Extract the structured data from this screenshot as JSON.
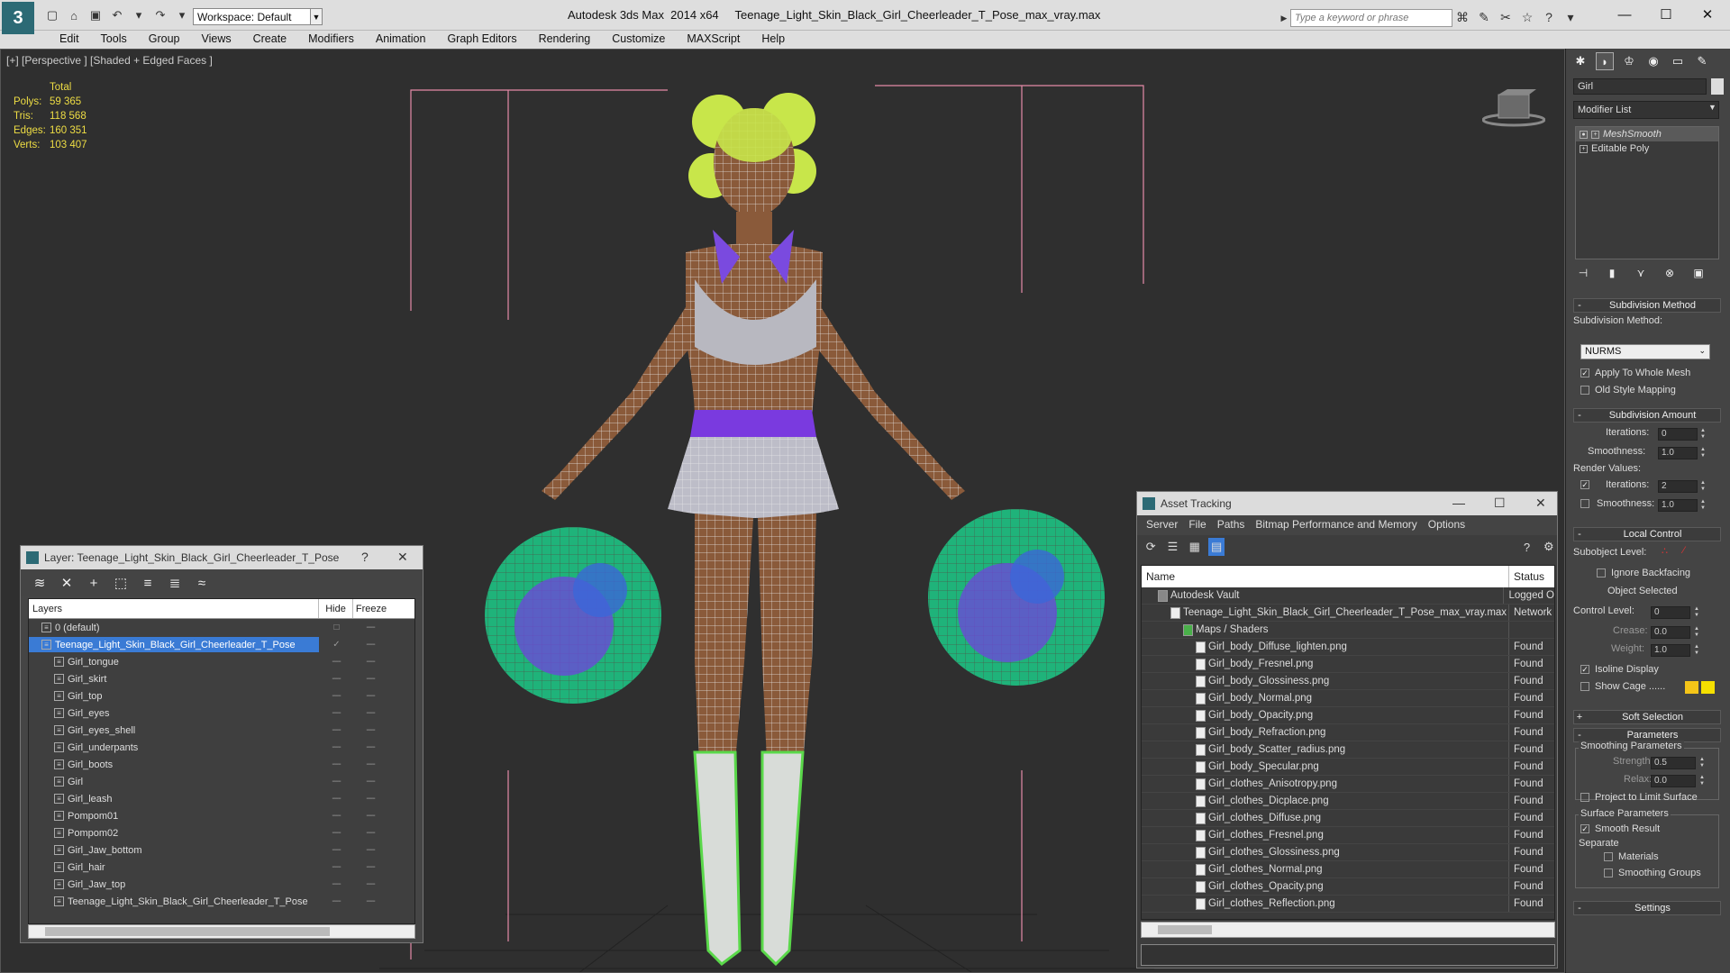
{
  "titlebar": {
    "workspace": "Workspace: Default",
    "app": "Autodesk 3ds Max  2014 x64",
    "file": "Teenage_Light_Skin_Black_Girl_Cheerleader_T_Pose_max_vray.max",
    "search_placeholder": "Type a keyword or phrase"
  },
  "menu": [
    "Edit",
    "Tools",
    "Group",
    "Views",
    "Create",
    "Modifiers",
    "Animation",
    "Graph Editors",
    "Rendering",
    "Customize",
    "MAXScript",
    "Help"
  ],
  "viewport": {
    "label": "[+] [Perspective ] [Shaded + Edged Faces ]",
    "stats_header": "Total",
    "stats": [
      {
        "label": "Polys:",
        "value": "59 365"
      },
      {
        "label": "Tris:",
        "value": "118 568"
      },
      {
        "label": "Edges:",
        "value": "160 351"
      },
      {
        "label": "Verts:",
        "value": "103 407"
      }
    ]
  },
  "layer_window": {
    "title": "Layer: Teenage_Light_Skin_Black_Girl_Cheerleader_T_Pose",
    "help": "?",
    "col_layers": "Layers",
    "col_hide": "Hide",
    "col_freeze": "Freeze",
    "rows": [
      {
        "name": "0 (default)",
        "indent": 1
      },
      {
        "name": "Teenage_Light_Skin_Black_Girl_Cheerleader_T_Pose",
        "indent": 1,
        "selected": true
      },
      {
        "name": "Girl_tongue",
        "indent": 2
      },
      {
        "name": "Girl_skirt",
        "indent": 2
      },
      {
        "name": "Girl_top",
        "indent": 2
      },
      {
        "name": "Girl_eyes",
        "indent": 2
      },
      {
        "name": "Girl_eyes_shell",
        "indent": 2
      },
      {
        "name": "Girl_underpants",
        "indent": 2
      },
      {
        "name": "Girl_boots",
        "indent": 2
      },
      {
        "name": "Girl",
        "indent": 2
      },
      {
        "name": "Girl_leash",
        "indent": 2
      },
      {
        "name": "Pompom01",
        "indent": 2
      },
      {
        "name": "Pompom02",
        "indent": 2
      },
      {
        "name": "Girl_Jaw_bottom",
        "indent": 2
      },
      {
        "name": "Girl_hair",
        "indent": 2
      },
      {
        "name": "Girl_Jaw_top",
        "indent": 2
      },
      {
        "name": "Teenage_Light_Skin_Black_Girl_Cheerleader_T_Pose",
        "indent": 2
      }
    ]
  },
  "asset_window": {
    "title": "Asset Tracking",
    "menu": [
      "Server",
      "File",
      "Paths",
      "Bitmap Performance and Memory",
      "Options"
    ],
    "col_name": "Name",
    "col_status": "Status",
    "rows": [
      {
        "name": "Autodesk Vault",
        "status": "Logged O",
        "indent": 1
      },
      {
        "name": "Teenage_Light_Skin_Black_Girl_Cheerleader_T_Pose_max_vray.max",
        "status": "Network",
        "indent": 2
      },
      {
        "name": "Maps / Shaders",
        "status": "",
        "indent": 3
      },
      {
        "name": "Girl_body_Diffuse_lighten.png",
        "status": "Found",
        "indent": 4
      },
      {
        "name": "Girl_body_Fresnel.png",
        "status": "Found",
        "indent": 4
      },
      {
        "name": "Girl_body_Glossiness.png",
        "status": "Found",
        "indent": 4
      },
      {
        "name": "Girl_body_Normal.png",
        "status": "Found",
        "indent": 4
      },
      {
        "name": "Girl_body_Opacity.png",
        "status": "Found",
        "indent": 4
      },
      {
        "name": "Girl_body_Refraction.png",
        "status": "Found",
        "indent": 4
      },
      {
        "name": "Girl_body_Scatter_radius.png",
        "status": "Found",
        "indent": 4
      },
      {
        "name": "Girl_body_Specular.png",
        "status": "Found",
        "indent": 4
      },
      {
        "name": "Girl_clothes_Anisotropy.png",
        "status": "Found",
        "indent": 4
      },
      {
        "name": "Girl_clothes_Dicplace.png",
        "status": "Found",
        "indent": 4
      },
      {
        "name": "Girl_clothes_Diffuse.png",
        "status": "Found",
        "indent": 4
      },
      {
        "name": "Girl_clothes_Fresnel.png",
        "status": "Found",
        "indent": 4
      },
      {
        "name": "Girl_clothes_Glossiness.png",
        "status": "Found",
        "indent": 4
      },
      {
        "name": "Girl_clothes_Normal.png",
        "status": "Found",
        "indent": 4
      },
      {
        "name": "Girl_clothes_Opacity.png",
        "status": "Found",
        "indent": 4
      },
      {
        "name": "Girl_clothes_Reflection.png",
        "status": "Found",
        "indent": 4
      }
    ]
  },
  "command_panel": {
    "object_name": "Girl",
    "modifier_list": "Modifier List",
    "stack": [
      "MeshSmooth",
      "Editable Poly"
    ],
    "subdivision_method_hdr": "Subdivision Method",
    "subdivision_method_lbl": "Subdivision Method:",
    "subdivision_method_val": "NURMS",
    "apply_whole_mesh": "Apply To Whole Mesh",
    "old_style_mapping": "Old Style Mapping",
    "subdivision_amount_hdr": "Subdivision Amount",
    "iterations_lbl": "Iterations:",
    "iterations_val": "0",
    "smoothness_lbl": "Smoothness:",
    "smoothness_val": "1.0",
    "render_values_lbl": "Render Values:",
    "render_iterations_val": "2",
    "render_smoothness_val": "1.0",
    "local_control_hdr": "Local Control",
    "subobject_level_lbl": "Subobject Level:",
    "ignore_backfacing": "Ignore Backfacing",
    "object_selected": "Object Selected",
    "control_level_lbl": "Control Level:",
    "control_level_val": "0",
    "crease_lbl": "Crease:",
    "crease_val": "0.0",
    "weight_lbl": "Weight:",
    "weight_val": "1.0",
    "isoline_display": "Isoline Display",
    "show_cage": "Show Cage ......",
    "soft_selection_hdr": "Soft Selection",
    "parameters_hdr": "Parameters",
    "smoothing_parameters": "Smoothing Parameters",
    "strength_lbl": "Strength:",
    "strength_val": "0.5",
    "relax_lbl": "Relax:",
    "relax_val": "0.0",
    "project_limit": "Project to Limit Surface",
    "surface_parameters": "Surface Parameters",
    "smooth_result": "Smooth Result",
    "separate_lbl": "Separate",
    "materials": "Materials",
    "smoothing_groups": "Smoothing Groups",
    "settings_hdr": "Settings"
  },
  "colors": {
    "selection": "#3a7bd5",
    "stats_text": "#eedd44",
    "cage_a": "#f5c518",
    "cage_b": "#f5e000"
  }
}
